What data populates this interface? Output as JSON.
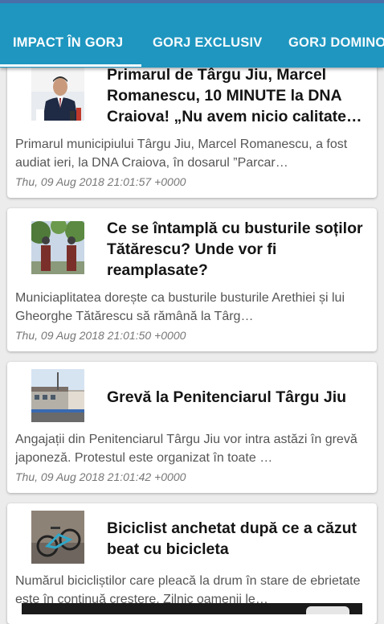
{
  "tabs": [
    {
      "label": "IMPACT ÎN GORJ",
      "selected": true
    },
    {
      "label": "GORJ EXCLUSIV",
      "selected": false
    },
    {
      "label": "GORJ DOMINO",
      "selected": false
    }
  ],
  "colors": {
    "app_bar": "#1e96c0",
    "status_strip": "#4a6ea8",
    "background": "#ececec"
  },
  "articles": [
    {
      "image": "man-at-microphones-photo",
      "title": "Primarul de Târgu Jiu, Marcel Romanescu, 10 MINUTE la DNA Craiova! „Nu avem nicio calitate …",
      "excerpt": "Primarul municipiului Târgu Jiu, Marcel Romanescu, a fost audiat ieri, la DNA Craiova, în dosarul ”Parcar…",
      "date": "Thu, 09 Aug 2018 21:01:57 +0000"
    },
    {
      "image": "busts-in-park-photo",
      "title": "Ce se întamplă cu busturile soților Tătărescu? Unde vor fi reamplasate?",
      "excerpt": "Municiaplitatea dorește ca busturile busturile Arethiei și lui Gheorghe Tătărescu să rămână la Târg…",
      "date": "Thu, 09 Aug 2018 21:01:50 +0000"
    },
    {
      "image": "penitentiary-building-photo",
      "title": "Grevă la Penitenciarul Târgu Jiu",
      "excerpt": "Angajații din Penitenciarul Târgu Jiu vor intra astăzi în grevă japoneză. Protestul este organizat în toate …",
      "date": "Thu, 09 Aug 2018 21:01:42 +0000"
    },
    {
      "image": "fallen-bicycle-photo",
      "title": "Biciclist anchetat după ce a căzut beat cu bicicleta",
      "excerpt": "Numărul bicicliștilor care pleacă la drum în stare de ebrietate este în continuă creștere. Zilnic oamenii le…",
      "date": ""
    }
  ]
}
